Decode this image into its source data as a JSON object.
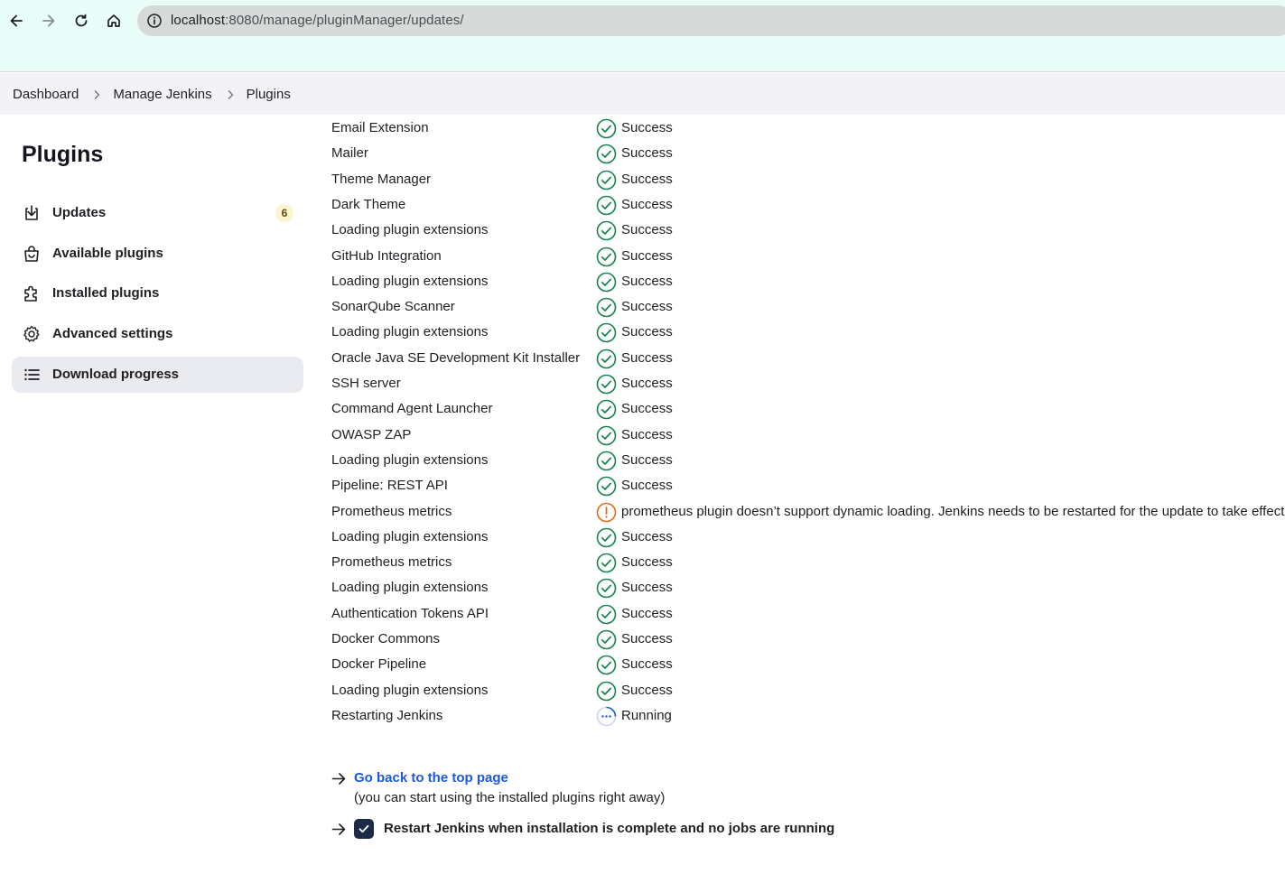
{
  "browser": {
    "url_host": "localhost",
    "url_rest": ":8080/manage/pluginManager/updates/"
  },
  "breadcrumb": [
    "Dashboard",
    "Manage Jenkins",
    "Plugins"
  ],
  "sidebar": {
    "title": "Plugins",
    "items": [
      {
        "label": "Updates",
        "icon": "download-icon",
        "badge": "6",
        "active": false
      },
      {
        "label": "Available plugins",
        "icon": "shopping-bag-icon",
        "active": false
      },
      {
        "label": "Installed plugins",
        "icon": "puzzle-icon",
        "active": false
      },
      {
        "label": "Advanced settings",
        "icon": "gear-icon",
        "active": false
      },
      {
        "label": "Download progress",
        "icon": "list-icon",
        "active": true
      }
    ]
  },
  "progress": [
    {
      "name": "Email Extension",
      "status": "success",
      "text": "Success"
    },
    {
      "name": "Mailer",
      "status": "success",
      "text": "Success"
    },
    {
      "name": "Theme Manager",
      "status": "success",
      "text": "Success"
    },
    {
      "name": "Dark Theme",
      "status": "success",
      "text": "Success"
    },
    {
      "name": "Loading plugin extensions",
      "status": "success",
      "text": "Success"
    },
    {
      "name": "GitHub Integration",
      "status": "success",
      "text": "Success"
    },
    {
      "name": "Loading plugin extensions",
      "status": "success",
      "text": "Success"
    },
    {
      "name": "SonarQube Scanner",
      "status": "success",
      "text": "Success"
    },
    {
      "name": "Loading plugin extensions",
      "status": "success",
      "text": "Success"
    },
    {
      "name": "Oracle Java SE Development Kit Installer",
      "status": "success",
      "text": "Success"
    },
    {
      "name": "SSH server",
      "status": "success",
      "text": "Success"
    },
    {
      "name": "Command Agent Launcher",
      "status": "success",
      "text": "Success"
    },
    {
      "name": "OWASP ZAP",
      "status": "success",
      "text": "Success"
    },
    {
      "name": "Loading plugin extensions",
      "status": "success",
      "text": "Success"
    },
    {
      "name": "Pipeline: REST API",
      "status": "success",
      "text": "Success"
    },
    {
      "name": "Prometheus metrics",
      "status": "warning",
      "text": "prometheus plugin doesn’t support dynamic loading. Jenkins needs to be restarted for the update to take effect."
    },
    {
      "name": "Loading plugin extensions",
      "status": "success",
      "text": "Success"
    },
    {
      "name": "Prometheus metrics",
      "status": "success",
      "text": "Success"
    },
    {
      "name": "Loading plugin extensions",
      "status": "success",
      "text": "Success"
    },
    {
      "name": "Authentication Tokens API",
      "status": "success",
      "text": "Success"
    },
    {
      "name": "Docker Commons",
      "status": "success",
      "text": "Success"
    },
    {
      "name": "Docker Pipeline",
      "status": "success",
      "text": "Success"
    },
    {
      "name": "Loading plugin extensions",
      "status": "success",
      "text": "Success"
    },
    {
      "name": "Restarting Jenkins",
      "status": "running",
      "text": "Running"
    }
  ],
  "footer": {
    "back_link": "Go back to the top page",
    "back_note": "(you can start using the installed plugins right away)",
    "restart_label": "Restart Jenkins when installation is complete and no jobs are running",
    "restart_checked": true
  },
  "colors": {
    "success": "#138347",
    "warning": "#e56a16",
    "running": "#1a59d8",
    "link": "#1a59d8"
  }
}
